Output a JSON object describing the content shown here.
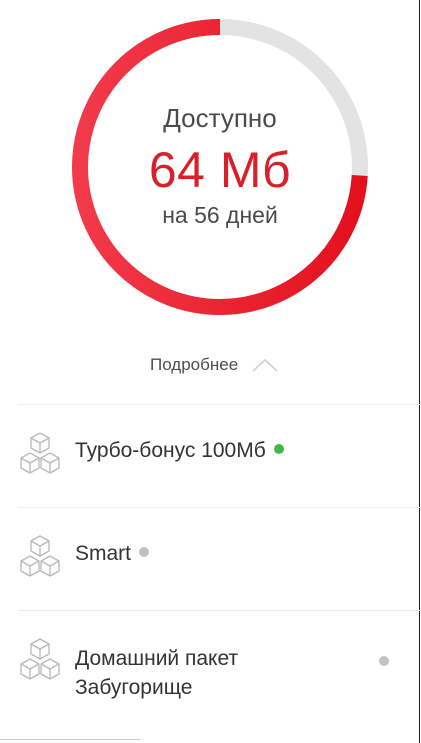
{
  "balance": {
    "title": "Доступно",
    "value": "64 Мб",
    "subtitle": "на 56 дней",
    "remaining_fraction": 0.74,
    "colors": {
      "progress_start": "#e3101d",
      "progress_end": "#f23a4a",
      "track": "#e3e3e3",
      "value_text": "#d9202a"
    }
  },
  "details_toggle": {
    "label": "Подробнее",
    "icon": "chevron-up-icon"
  },
  "packages": [
    {
      "name": "Турбо-бонус 100Мб",
      "status_color": "#3fba4a",
      "icon": "cubes-icon"
    },
    {
      "name": "Smart",
      "status_color": "#c2c2c2",
      "icon": "cubes-icon"
    },
    {
      "name_line1": "Домашний пакет",
      "name_line2": "Забугорище",
      "status_color": "#c2c2c2",
      "icon": "cubes-icon"
    }
  ]
}
